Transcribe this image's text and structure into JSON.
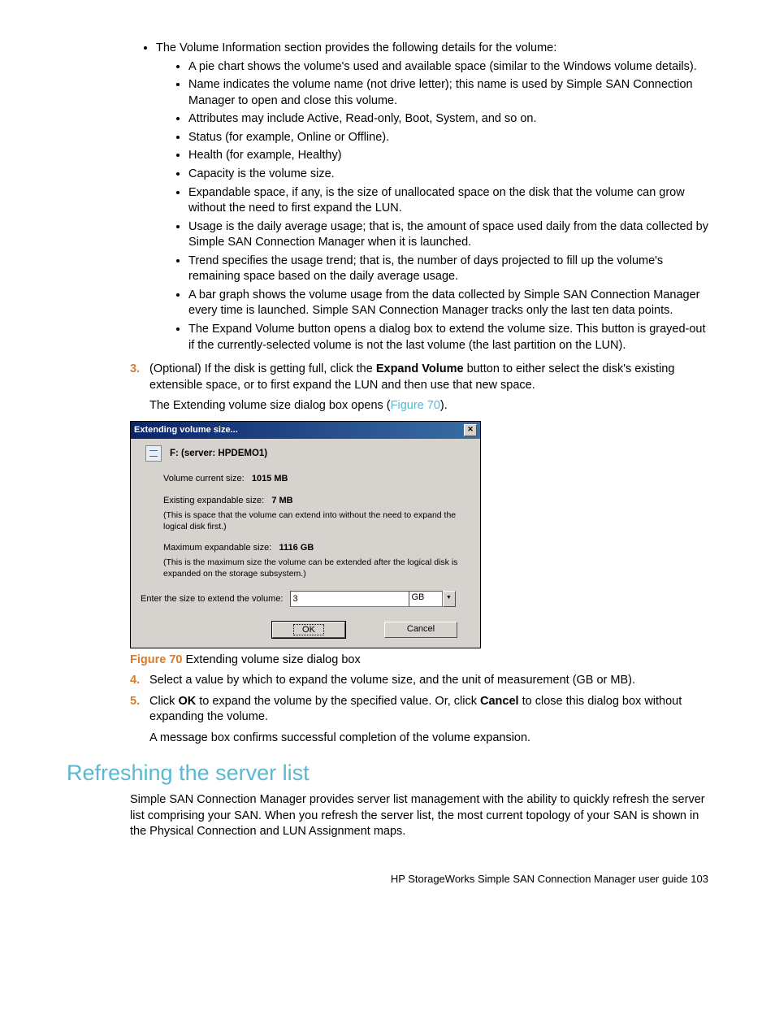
{
  "intro_bullet": "The Volume Information section provides the following details for the volume:",
  "sub_bullets": [
    "A pie chart shows the volume's used and available space (similar to the Windows volume details).",
    "Name indicates the volume name (not drive letter); this name is used by Simple SAN Connection Manager to open and close this volume.",
    "Attributes may include Active, Read-only, Boot, System, and so on.",
    "Status (for example, Online or Offline).",
    "Health (for example, Healthy)",
    "Capacity is the volume size.",
    "Expandable space, if any, is the size of unallocated space on the disk that the volume can grow without the need to first expand the LUN.",
    "Usage is the daily average usage; that is, the amount of space used daily from the data collected by Simple SAN Connection Manager when it is launched.",
    "Trend specifies the usage trend; that is, the number of days projected to fill up the volume's remaining space based on the daily average usage.",
    "A bar graph shows the volume usage from the data collected by Simple SAN Connection Manager every time is launched. Simple SAN Connection Manager tracks only the last ten data points.",
    "The Expand Volume button opens a dialog box to extend the volume size. This button is grayed-out if the currently-selected volume is not the last volume (the last partition on the LUN)."
  ],
  "step3": {
    "num": "3.",
    "text_pre": "(Optional) If the disk is getting full, click the ",
    "bold1": "Expand Volume",
    "text_post": " button to either select the disk's existing extensible space, or to first expand the LUN and then use that new space.",
    "para2_pre": "The Extending volume size dialog box opens (",
    "fig_link": "Figure 70",
    "para2_post": ")."
  },
  "dialog": {
    "title": "Extending volume size...",
    "close": "✕",
    "header": "F: (server: HPDEMO1)",
    "current_label": "Volume current size:",
    "current_value": "1015 MB",
    "existing_label": "Existing expandable size:",
    "existing_value": "7 MB",
    "existing_note": "(This is space that the volume can extend into without the need to expand the logical disk first.)",
    "max_label": "Maximum expandable size:",
    "max_value": "1116 GB",
    "max_note": "(This is the maximum size the volume can be extended after the logical disk is expanded on the storage subsystem.)",
    "input_label": "Enter the size to extend the volume:",
    "input_value": "3",
    "unit_value": "GB",
    "ok": "OK",
    "cancel": "Cancel"
  },
  "figure_caption": {
    "num": "Figure 70",
    "text": " Extending volume size dialog box"
  },
  "step4": {
    "num": "4.",
    "text": "Select a value by which to expand the volume size, and the unit of measurement (GB or MB)."
  },
  "step5": {
    "num": "5.",
    "pre": "Click ",
    "b1": "OK",
    "mid": " to expand the volume by the specified value. Or, click ",
    "b2": "Cancel",
    "post": " to close this dialog box without expanding the volume.",
    "para2": "A message box confirms successful completion of the volume expansion."
  },
  "section_heading": "Refreshing the server list",
  "section_para": "Simple SAN Connection Manager provides server list management with the ability to quickly refresh the server list comprising your SAN. When you refresh the server list, the most current topology of your SAN is shown in the Physical Connection and LUN Assignment maps.",
  "footer": "HP StorageWorks Simple SAN Connection Manager user guide   103"
}
